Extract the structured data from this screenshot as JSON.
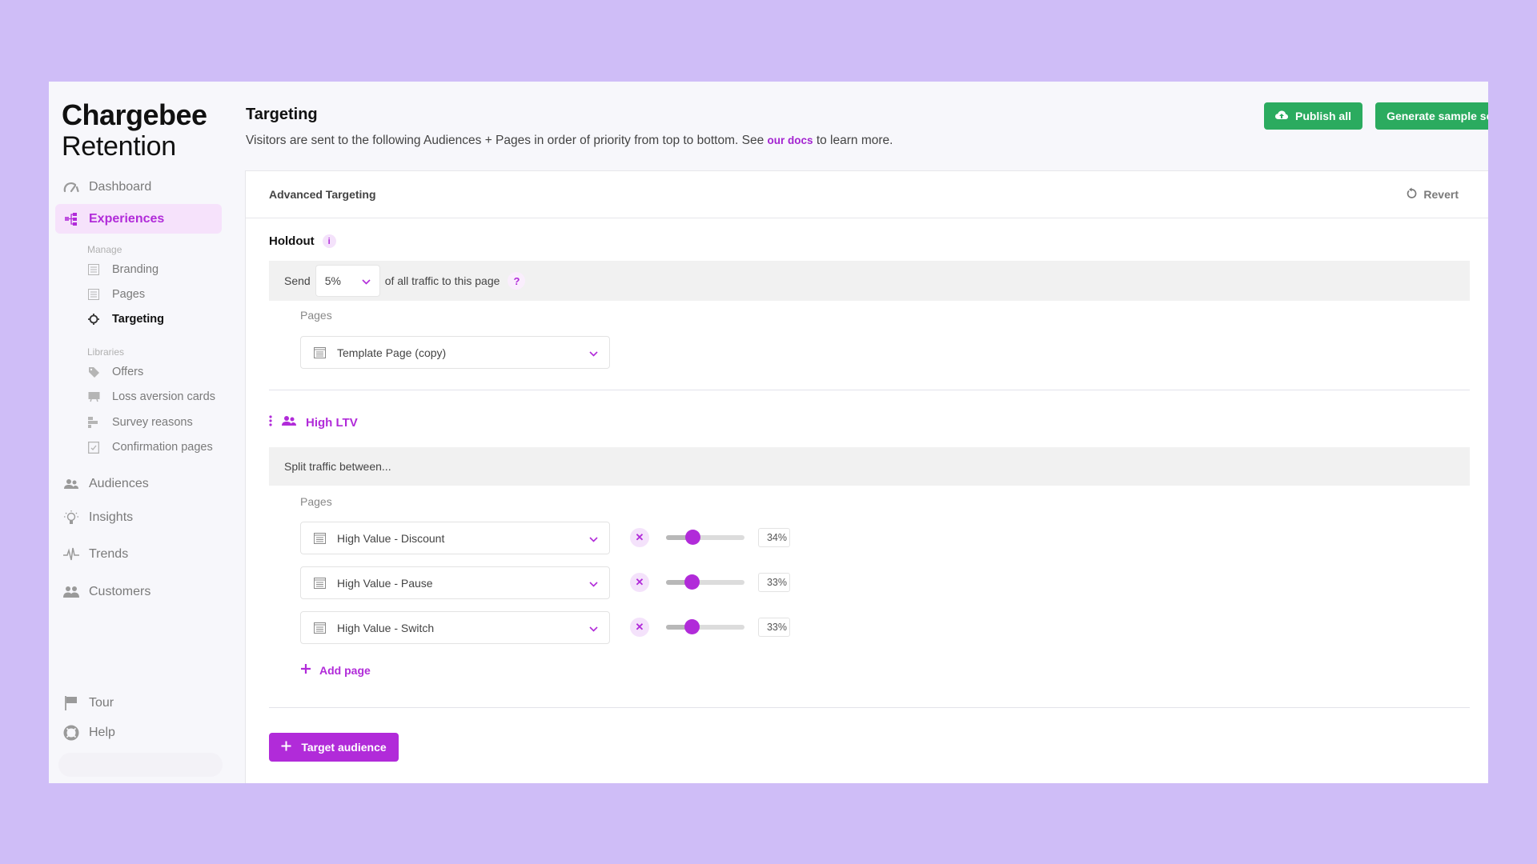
{
  "logo": {
    "line1": "Chargebee",
    "line2": "Retention"
  },
  "sidebar": {
    "nav": [
      {
        "label": "Dashboard",
        "icon": "gauge-icon"
      },
      {
        "label": "Experiences",
        "icon": "flow-icon",
        "active": true
      },
      {
        "label": "Audiences",
        "icon": "users-icon"
      },
      {
        "label": "Insights",
        "icon": "lightbulb-icon"
      },
      {
        "label": "Trends",
        "icon": "pulse-icon"
      },
      {
        "label": "Customers",
        "icon": "customers-icon"
      }
    ],
    "manage_label": "Manage",
    "manage": [
      {
        "label": "Branding",
        "icon": "page-icon"
      },
      {
        "label": "Pages",
        "icon": "page-icon"
      },
      {
        "label": "Targeting",
        "icon": "crosshair-icon",
        "active": true
      }
    ],
    "libraries_label": "Libraries",
    "libraries": [
      {
        "label": "Offers",
        "icon": "tag-icon"
      },
      {
        "label": "Loss aversion cards",
        "icon": "cards-icon"
      },
      {
        "label": "Survey reasons",
        "icon": "list-icon"
      },
      {
        "label": "Confirmation pages",
        "icon": "check-page-icon"
      }
    ],
    "footer": [
      {
        "label": "Tour",
        "icon": "flag-icon"
      },
      {
        "label": "Help",
        "icon": "lifebuoy-icon"
      }
    ]
  },
  "header": {
    "title": "Targeting",
    "description_before": "Visitors are sent to the following Audiences + Pages in order of priority from top to bottom. See ",
    "docs_link": "our docs",
    "description_after": " to learn more.",
    "publish_label": "Publish all",
    "generate_label": "Generate sample session"
  },
  "card": {
    "title": "Advanced Targeting",
    "revert_label": "Revert",
    "holdout": {
      "title": "Holdout",
      "info": "i",
      "send_label": "Send",
      "percent_selected": "5%",
      "traffic_text": "of all traffic to this page",
      "help": "?",
      "pages_label": "Pages",
      "page": "Template Page (copy)"
    },
    "audience": {
      "name": "High LTV",
      "split_text": "Split traffic between...",
      "pages_label": "Pages",
      "pages": [
        {
          "name": "High Value - Discount",
          "percent": 34,
          "percent_label": "34%"
        },
        {
          "name": "High Value - Pause",
          "percent": 33,
          "percent_label": "33%"
        },
        {
          "name": "High Value - Switch",
          "percent": 33,
          "percent_label": "33%"
        }
      ],
      "add_page_label": "Add page"
    },
    "target_audience_label": "Target audience"
  },
  "colors": {
    "accent": "#b12bd9",
    "accent_light": "#f4e2fb",
    "green": "#2bab5f",
    "background": "#cfbdf7"
  }
}
